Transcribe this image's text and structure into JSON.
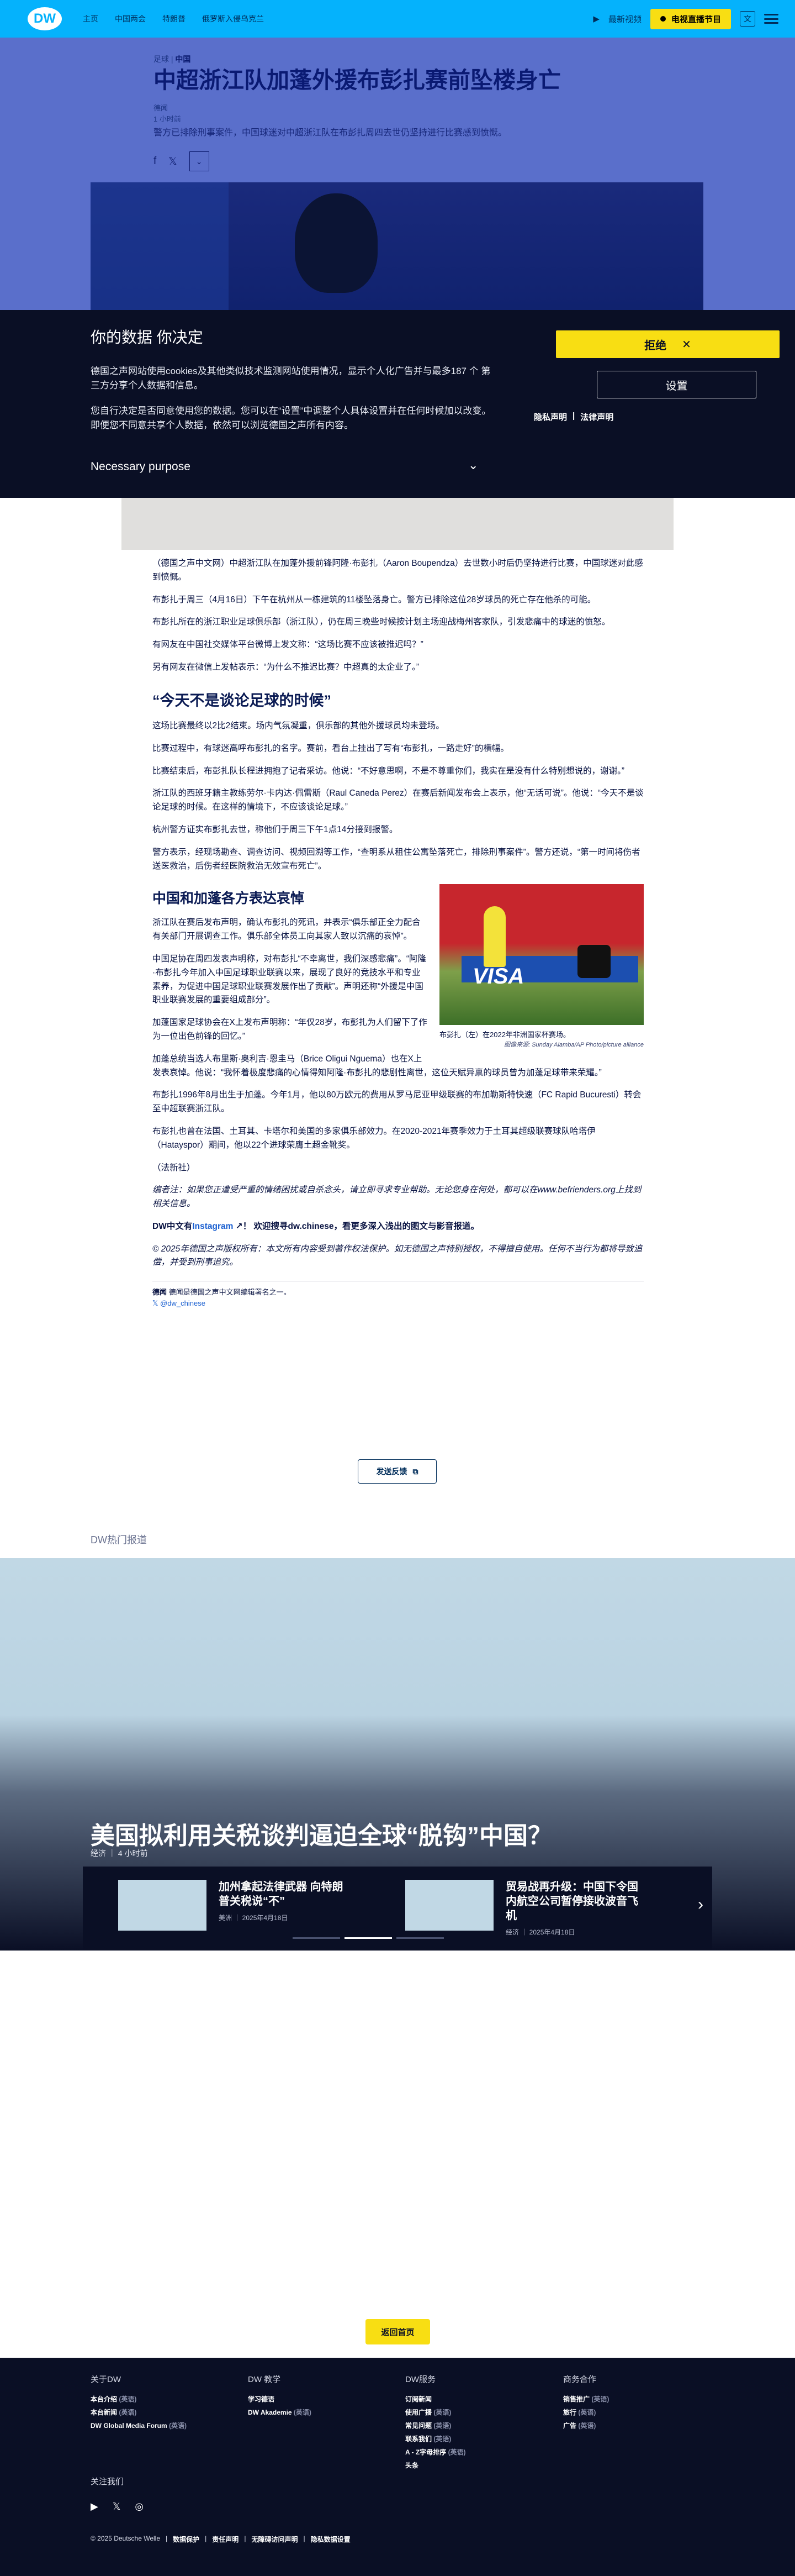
{
  "header": {
    "logo": "DW",
    "nav": [
      "主页",
      "中国两会",
      "特朗普",
      "俄罗斯入侵乌克兰"
    ],
    "latest_video": "最新视频",
    "live_button": "电视直播节目"
  },
  "article": {
    "breadcrumb_tag": "足球",
    "breadcrumb_region": "中国",
    "title": "中超浙江队加蓬外援布彭扎赛前坠楼身亡",
    "author": "德闻",
    "time": "1 小时前",
    "teaser": "警方已排除刑事案件，中国球迷对中超浙江队在布彭扎周四去世仍坚持进行比赛感到愤慨。",
    "paragraphs": [
      "（德国之声中文网）中超浙江队在加蓬外援前锋阿隆·布彭扎（Aaron Boupendza）去世数小时后仍坚持进行比赛，中国球迷对此感到愤慨。",
      "布彭扎于周三（4月16日）下午在杭州从一栋建筑的11楼坠落身亡。警方已排除这位28岁球员的死亡存在他杀的可能。",
      "布彭扎所在的浙江职业足球俱乐部（浙江队），仍在周三晚些时候按计划主场迎战梅州客家队，引发悲痛中的球迷的愤怒。",
      "有网友在中国社交媒体平台微博上发文称：“这场比赛不应该被推迟吗？”",
      "另有网友在微信上发帖表示：“为什么不推迟比赛？中超真的太企业了。”"
    ],
    "section1_title": "“今天不是谈论足球的时候”",
    "section1": [
      "这场比赛最终以2比2结束。场内气氛凝重，俱乐部的其他外援球员均未登场。",
      "比赛过程中，有球迷高呼布彭扎的名字。赛前，看台上挂出了写有“布彭扎，一路走好”的横幅。",
      "比赛结束后，布彭扎队长程进拥抱了记者采访。他说：“不好意思啊，不是不尊重你们，我实在是没有什么特别想说的，谢谢。”",
      "浙江队的西班牙籍主教练劳尔·卡内达·佩雷斯（Raul Caneda Perez）在赛后新闻发布会上表示，他“无话可说”。他说：“今天不是谈论足球的时候。在这样的情境下，不应该谈论足球。”",
      "杭州警方证实布彭扎去世，称他们于周三下午1点14分接到报警。",
      "警方表示，经现场勘查、调查访问、视频回溯等工作，“查明系从租住公寓坠落死亡，排除刑事案件”。警方还说，“第一时间将伤者送医救治，后伤者经医院救治无效宣布死亡”。"
    ],
    "section2_title": "中国和加蓬各方表达哀悼",
    "section2": [
      "浙江队在赛后发布声明，确认布彭扎的死讯，并表示“俱乐部正全力配合有关部门开展调查工作。俱乐部全体员工向其家人致以沉痛的哀悼”。",
      "中国足协在周四发表声明称，对布彭扎“不幸离世，我们深感悲痛”。“阿隆·布彭扎今年加入中国足球职业联赛以来，展现了良好的竞技水平和专业素养，为促进中国足球职业联赛发展作出了贡献”。声明还称“外援是中国职业联赛发展的重要组成部分”。",
      "加蓬国家足球协会在X上发布声明称：“年仅28岁，布彭扎为人们留下了作为一位出色前锋的回忆。”",
      "加蓬总统当选人布里斯·奥利吉·恩圭马（Brice Oligui Nguema）也在X上发表哀悼。他说：“我怀着极度悲痛的心情得知阿隆·布彭扎的悲剧性离世，这位天赋异禀的球员曾为加蓬足球带来荣耀。”",
      "布彭扎1996年8月出生于加蓬。今年1月，他以80万欧元的费用从罗马尼亚甲级联赛的布加勒斯特快速（FC Rapid Bucuresti）转会至中超联赛浙江队。",
      "布彭扎也曾在法国、土耳其、卡塔尔和美国的多家俱乐部效力。在2020-2021年赛季效力于土耳其超级联赛球队哈塔伊（Hatayspor）期间，他以22个进球荣膺土超金靴奖。"
    ],
    "figure_caption": "布彭扎（左）在2022年非洲国家杯赛场。",
    "figure_credit": "图像来源: Sunday Alamba/AP Photo/picture alliance",
    "figure_visa": "VISA",
    "source": "（法新社）",
    "editor_note": "编者注：如果您正遭受严重的情绪困扰或自杀念头，请立即寻求专业帮助。无论您身在何处，都可以在www.befrienders.org上找到相关信息。",
    "ig_prefix": "DW中文有",
    "ig_link": "Instagram",
    "ig_suffix": "！ 欢迎搜寻dw.chinese，看更多深入浅出的图文与影音报道。",
    "copyright": "© 2025年德国之声版权所有：本文所有内容受到著作权法保护。如无德国之声特别授权，不得擅自使用。任何不当行为都将导致追偿，并受到刑事追究。",
    "author_name": "德闻",
    "author_bio": "德闻是德国之声中文网编辑署名之一。",
    "author_twitter": "@dw_chinese",
    "feedback": "发送反馈"
  },
  "consent": {
    "title": "你的数据 你决定",
    "text1": "德国之声网站使用cookies及其他类似技术监测网站使用情况，显示个人化广告并与最多187 个 第三方分享个人数据和信息。",
    "text2": "您自行决定是否同意使用您的数据。您可以在“设置”中调整个人具体设置并在任何时候加以改变。即便您不同意共享个人数据，依然可以浏览德国之声所有内容。",
    "purpose": "Necessary purpose",
    "reject": "拒绝",
    "settings": "设置",
    "privacy": "隐私声明",
    "legal": "法律声明"
  },
  "popular": {
    "label": "DW热门报道",
    "main_title": "美国拟利用关税谈判逼迫全球“脱钩”中国？",
    "main_meta": "经济 ｜ 4 小时前",
    "cards": [
      {
        "title": "加州拿起法律武器 向特朗普关税说“不”",
        "meta": "美洲 ｜ 2025年4月18日"
      },
      {
        "title": "贸易战再升级：中国下令国内航空公司暂停接收波音飞机",
        "meta": "经济 ｜ 2025年4月18日"
      }
    ]
  },
  "back_to_top": "返回首页",
  "footer": {
    "col1": {
      "title": "关于DW",
      "items": [
        [
          "本台介绍",
          "(英语)"
        ],
        [
          "本台新闻",
          "(英语)"
        ],
        [
          "DW Global Media Forum",
          "(英语)"
        ]
      ]
    },
    "col2": {
      "title": "DW 教学",
      "items": [
        [
          "学习德语",
          ""
        ],
        [
          "DW Akademie",
          "(英语)"
        ]
      ]
    },
    "col3": {
      "title": "DW服务",
      "items": [
        [
          "订阅新闻",
          ""
        ],
        [
          "使用广播",
          "(英语)"
        ],
        [
          "常见问题",
          "(英语)"
        ],
        [
          "联系我们",
          "(英语)"
        ],
        [
          "A - Z字母排序",
          "(英语)"
        ],
        [
          "头条",
          ""
        ]
      ]
    },
    "col4": {
      "title": "商务合作",
      "items": [
        [
          "销售推广",
          "(英语)"
        ],
        [
          "旅行",
          "(英语)"
        ],
        [
          "广告",
          "(英语)"
        ]
      ]
    },
    "follow": "关注我们",
    "legal": [
      "© 2025 Deutsche Welle",
      "数据保护",
      "责任声明",
      "无障碍访问声明",
      "隐私数据设置"
    ]
  },
  "colors": {
    "brand": "#05b2fc",
    "live": "#f8de13",
    "dark": "#0a0f25",
    "hero": "#5a6fcb"
  }
}
